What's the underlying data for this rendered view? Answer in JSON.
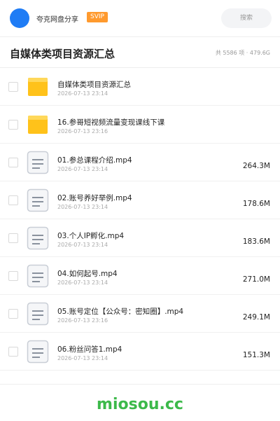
{
  "header": {
    "app_name": "夸克网盘分享",
    "badge": "SVIP",
    "search_placeholder": "搜索"
  },
  "folder": {
    "title": "自媒体类项目资源汇总",
    "summary": "共 5586 项 · 479.6G"
  },
  "items": [
    {
      "type": "folder",
      "name": "自媒体类项目资源汇总",
      "date": "2026-07-13 23:14",
      "size": ""
    },
    {
      "type": "folder",
      "name": "16.参哥短视频流量变现课线下课",
      "date": "2026-07-13 23:16",
      "size": ""
    },
    {
      "type": "file",
      "name": "01.参总课程介绍.mp4",
      "date": "2026-07-13 23:14",
      "size": "264.3M"
    },
    {
      "type": "file",
      "name": "02.账号养好举例.mp4",
      "date": "2026-07-13 23:14",
      "size": "178.6M"
    },
    {
      "type": "file",
      "name": "03.个人IP孵化.mp4",
      "date": "2026-07-13 23:14",
      "size": "183.6M"
    },
    {
      "type": "file",
      "name": "04.如何起号.mp4",
      "date": "2026-07-13 23:14",
      "size": "271.0M"
    },
    {
      "type": "file",
      "name": "05.账号定位【公众号：密知圈】.mp4",
      "date": "2026-07-13 23:16",
      "size": "249.1M"
    },
    {
      "type": "file",
      "name": "06.粉丝问答1.mp4",
      "date": "2026-07-13 23:14",
      "size": "151.3M"
    }
  ],
  "icons": {
    "folder": "folder-icon",
    "file": "video-file-icon"
  },
  "colors": {
    "accent": "#1f7cf5",
    "badge": "#ff9a2e",
    "folder": "#ffc21a",
    "watermark": "#3cb94a"
  },
  "watermark": "miosou.cc"
}
